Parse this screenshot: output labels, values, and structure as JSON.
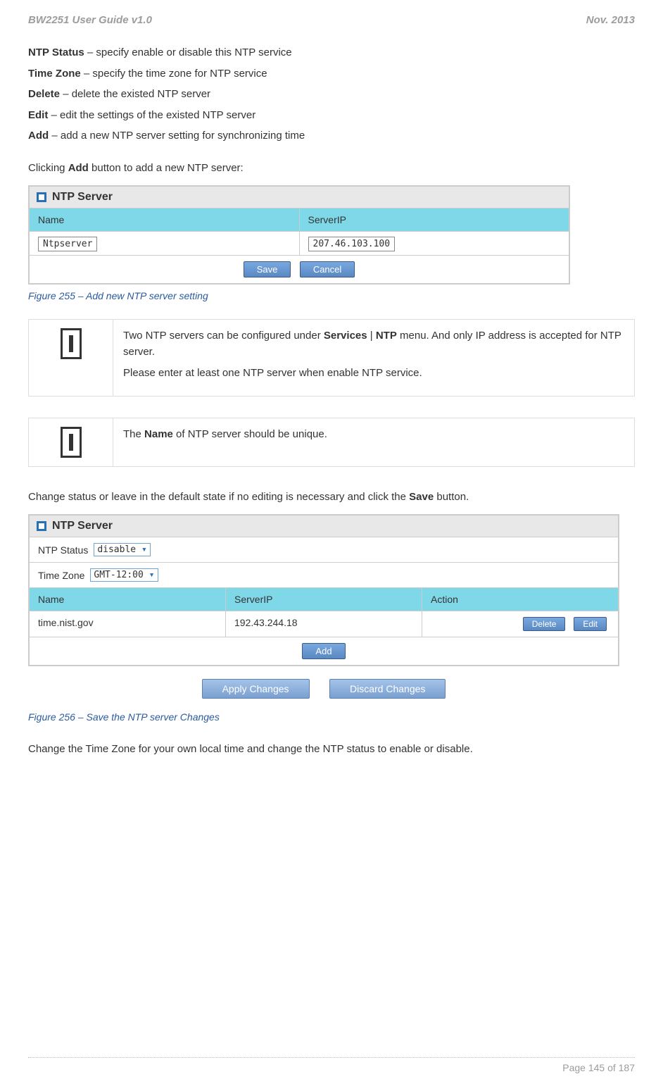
{
  "header": {
    "left": "BW2251 User Guide v1.0",
    "right": "Nov.  2013"
  },
  "defs": [
    {
      "term": "NTP Status",
      "desc": " – specify enable or disable this NTP service"
    },
    {
      "term": "Time Zone",
      "desc": " – specify the time zone for NTP service"
    },
    {
      "term": "Delete",
      "desc": " – delete the existed NTP server"
    },
    {
      "term": "Edit",
      "desc": " – edit the settings of the existed NTP server"
    },
    {
      "term": "Add",
      "desc": " – add a new NTP server setting for synchronizing time"
    }
  ],
  "click_add": {
    "pre": "Clicking ",
    "bold": "Add",
    "post": " button to add a new NTP server:"
  },
  "ss1": {
    "title": "NTP Server",
    "name_header": "Name",
    "ip_header": "ServerIP",
    "name_val": "Ntpserver",
    "ip_val": "207.46.103.100",
    "save_btn": "Save",
    "cancel_btn": "Cancel"
  },
  "fig255": "Figure 255 – Add new NTP server setting",
  "note1": {
    "line1a": "Two NTP servers can be configured under ",
    "line1b": "Services",
    "line1c": " | ",
    "line1d": "NTP",
    "line1e": " menu. And only IP address is accepted for NTP server.",
    "line2": "Please enter at least one NTP server when enable NTP service."
  },
  "note2": {
    "pre": "The ",
    "bold": "Name",
    "post": " of NTP server should be unique."
  },
  "change_status": {
    "pre": "Change status or leave in the default state if no editing is necessary and click the ",
    "bold": "Save",
    "post": " button."
  },
  "ss2": {
    "title": "NTP Server",
    "status_label": "NTP Status",
    "status_val": "disable",
    "tz_label": "Time Zone",
    "tz_val": "GMT-12:00",
    "name_header": "Name",
    "ip_header": "ServerIP",
    "action_header": "Action",
    "name_val": "time.nist.gov",
    "ip_val": "192.43.244.18",
    "delete_btn": "Delete",
    "edit_btn": "Edit",
    "add_btn": "Add",
    "apply_btn": "Apply Changes",
    "discard_btn": "Discard Changes"
  },
  "fig256": "Figure 256 – Save the NTP server Changes",
  "change_tz": "Change the Time Zone for your own local time and change the NTP status to enable or disable.",
  "footer": {
    "page": "Page 145 of 187"
  }
}
